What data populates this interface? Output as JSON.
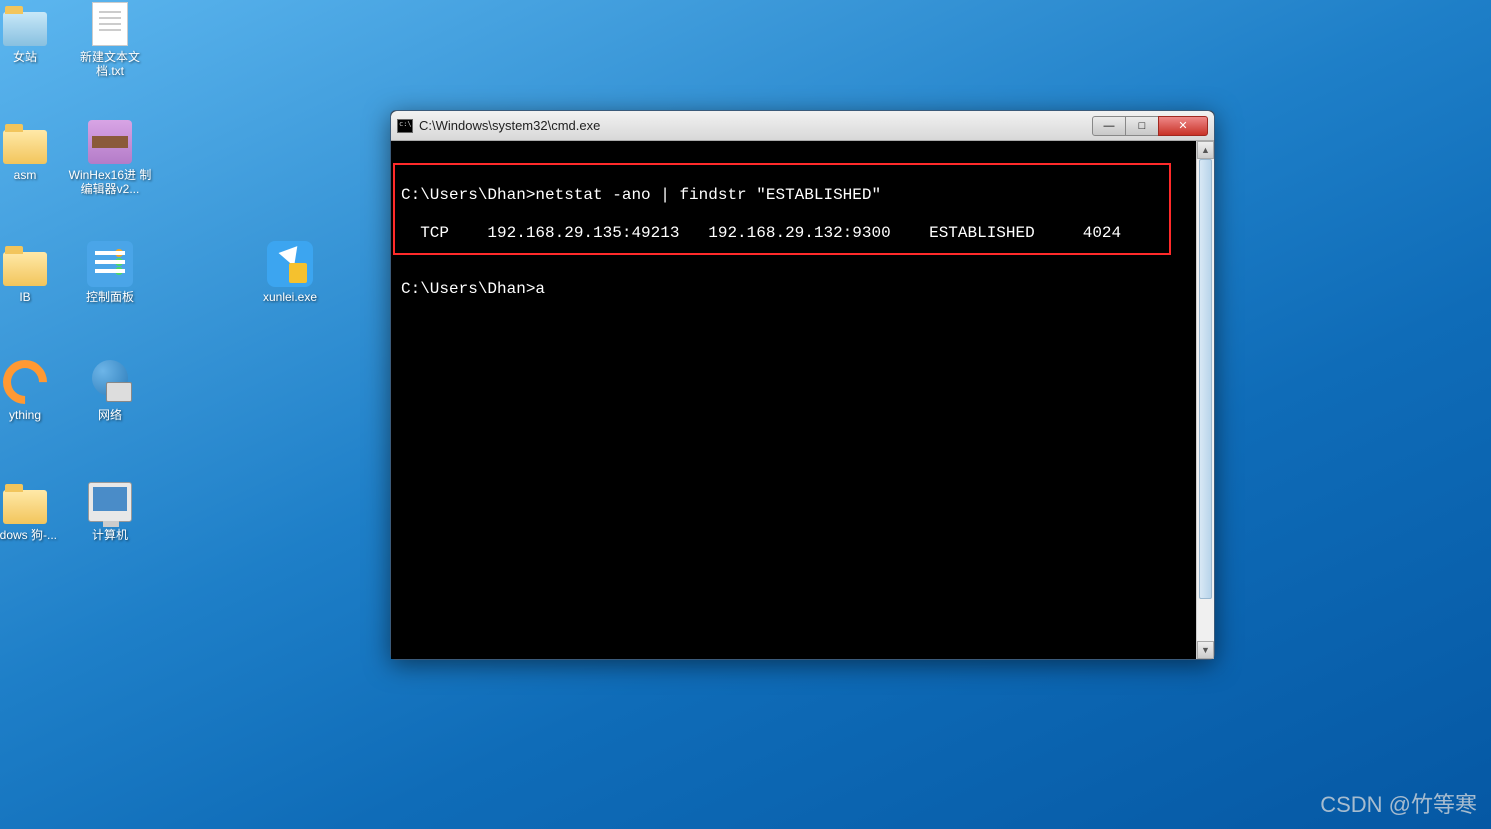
{
  "desktop": {
    "icons": [
      {
        "label": "女站"
      },
      {
        "label": "新建文本文\n档.txt"
      },
      {
        "label": "asm"
      },
      {
        "label": "WinHex16进\n制编辑器v2..."
      },
      {
        "label": "IB"
      },
      {
        "label": "控制面板"
      },
      {
        "label": "xunlei.exe"
      },
      {
        "label": "ything"
      },
      {
        "label": "网络"
      },
      {
        "label": "ndows\n狗-..."
      },
      {
        "label": "计算机"
      }
    ]
  },
  "cmd": {
    "title": "C:\\Windows\\system32\\cmd.exe",
    "lines": {
      "l0": "",
      "l1": "C:\\Users\\Dhan>netstat -ano | findstr \"ESTABLISHED\"",
      "l2": "  TCP    192.168.29.135:49213   192.168.29.132:9300    ESTABLISHED     4024",
      "l3": "",
      "l4": "C:\\Users\\Dhan>a"
    },
    "controls": {
      "min": "—",
      "max": "□",
      "close": "✕"
    }
  },
  "watermark": "CSDN @竹等寒"
}
